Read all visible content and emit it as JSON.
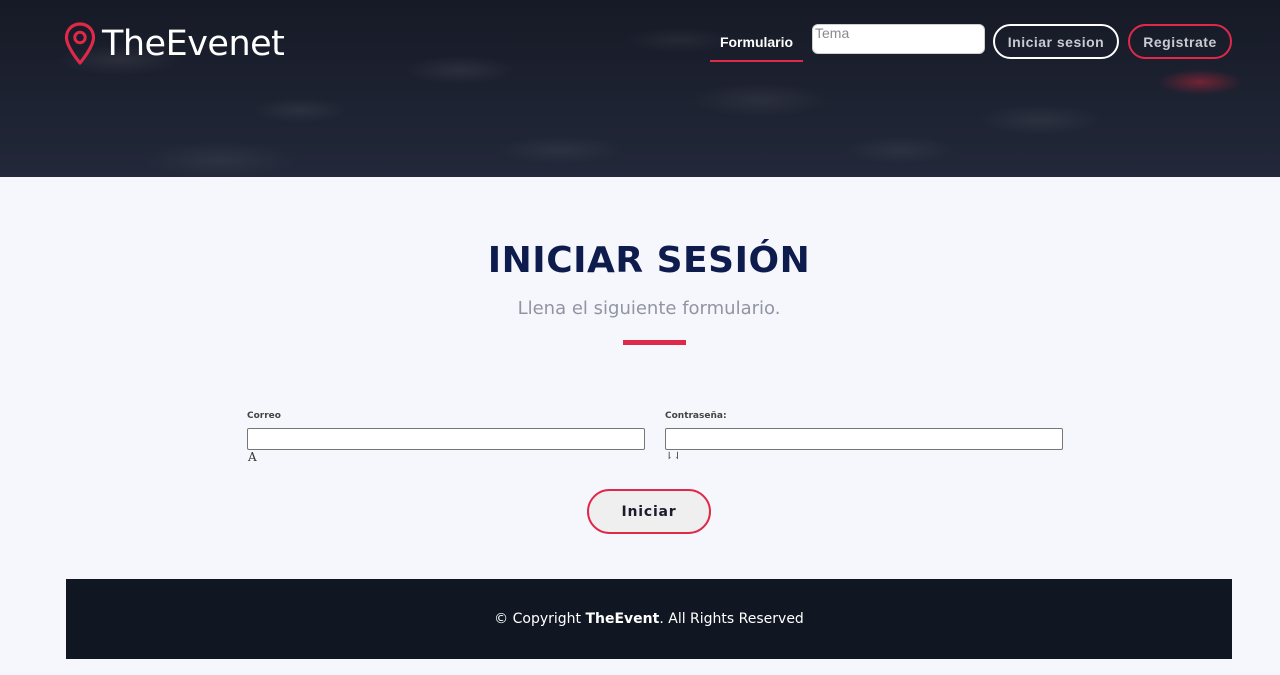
{
  "header": {
    "brand": "TheEvenet",
    "nav": {
      "formulario_label": "Formulario"
    },
    "search": {
      "placeholder": "Tema"
    },
    "login_button": "Iniciar sesion",
    "register_button": "Registrate",
    "accent_color": "#e0294a"
  },
  "main": {
    "title": "INICIAR SESIÓN",
    "subtitle": "Llena el siguiente formulario.",
    "email_label": "Correo",
    "email_hint": "A",
    "password_label": "Contraseña:",
    "password_hint": "⇂⇃",
    "submit_button": "Iniciar"
  },
  "footer": {
    "prefix": "© Copyright ",
    "brand": "TheEvent",
    "suffix": ". All Rights Reserved"
  },
  "icons": {
    "logo": "map-pin-icon"
  }
}
